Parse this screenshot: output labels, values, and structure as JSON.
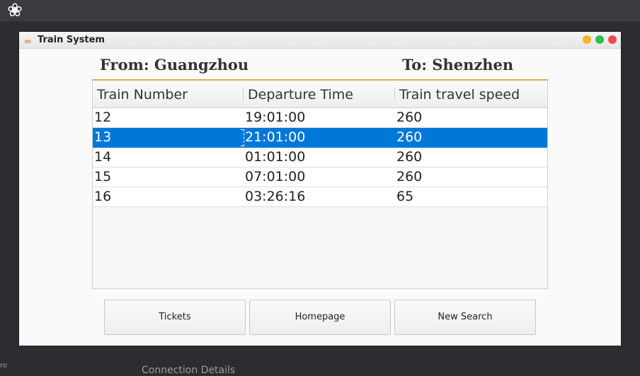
{
  "desktop": {
    "logo_icon": "gnome-foot-icon",
    "bottom_fragment": "Connection Details",
    "left_fragment": "ro"
  },
  "window": {
    "title": "Train System",
    "app_icon": "coffee-cup-icon",
    "controls": [
      "minimize",
      "maximize",
      "close"
    ],
    "colors": {
      "minimize": "#f5b52a",
      "maximize": "#2fbf4a",
      "close": "#ed4b4b"
    }
  },
  "route": {
    "from": "From: Guangzhou",
    "to": "To: Shenzhen"
  },
  "table": {
    "columns": [
      "Train Number",
      "Departure Time",
      "Train travel speed"
    ],
    "rows": [
      [
        "12",
        "19:01:00",
        "260"
      ],
      [
        "13",
        "21:01:00",
        "260"
      ],
      [
        "14",
        "01:01:00",
        "260"
      ],
      [
        "15",
        "07:01:00",
        "260"
      ],
      [
        "16",
        "03:26:16",
        "65"
      ]
    ],
    "selected_row": 2,
    "selection_color": "#0078d7",
    "header_accent": "#e9a84c"
  },
  "buttons": {
    "tickets": "Tickets",
    "homepage": "Homepage",
    "new_search": "New Search"
  }
}
